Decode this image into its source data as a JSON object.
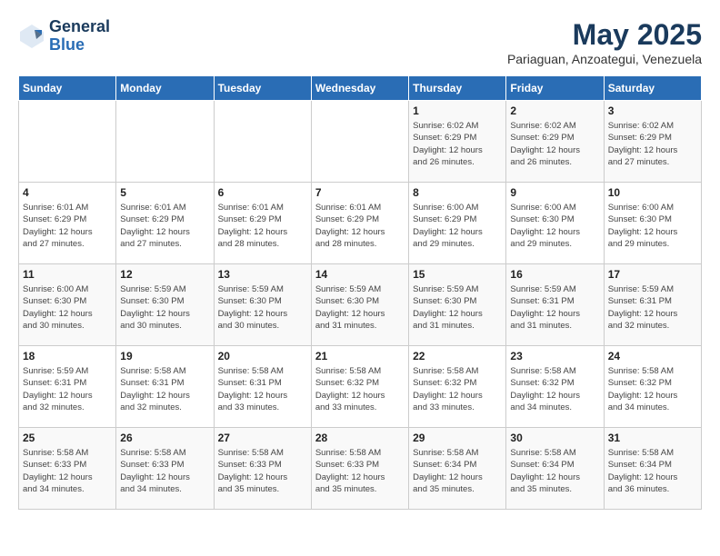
{
  "logo": {
    "general": "General",
    "blue": "Blue"
  },
  "title": "May 2025",
  "subtitle": "Pariaguan, Anzoategui, Venezuela",
  "days_of_week": [
    "Sunday",
    "Monday",
    "Tuesday",
    "Wednesday",
    "Thursday",
    "Friday",
    "Saturday"
  ],
  "weeks": [
    [
      {
        "day": "",
        "info": ""
      },
      {
        "day": "",
        "info": ""
      },
      {
        "day": "",
        "info": ""
      },
      {
        "day": "",
        "info": ""
      },
      {
        "day": "1",
        "info": "Sunrise: 6:02 AM\nSunset: 6:29 PM\nDaylight: 12 hours\nand 26 minutes."
      },
      {
        "day": "2",
        "info": "Sunrise: 6:02 AM\nSunset: 6:29 PM\nDaylight: 12 hours\nand 26 minutes."
      },
      {
        "day": "3",
        "info": "Sunrise: 6:02 AM\nSunset: 6:29 PM\nDaylight: 12 hours\nand 27 minutes."
      }
    ],
    [
      {
        "day": "4",
        "info": "Sunrise: 6:01 AM\nSunset: 6:29 PM\nDaylight: 12 hours\nand 27 minutes."
      },
      {
        "day": "5",
        "info": "Sunrise: 6:01 AM\nSunset: 6:29 PM\nDaylight: 12 hours\nand 27 minutes."
      },
      {
        "day": "6",
        "info": "Sunrise: 6:01 AM\nSunset: 6:29 PM\nDaylight: 12 hours\nand 28 minutes."
      },
      {
        "day": "7",
        "info": "Sunrise: 6:01 AM\nSunset: 6:29 PM\nDaylight: 12 hours\nand 28 minutes."
      },
      {
        "day": "8",
        "info": "Sunrise: 6:00 AM\nSunset: 6:29 PM\nDaylight: 12 hours\nand 29 minutes."
      },
      {
        "day": "9",
        "info": "Sunrise: 6:00 AM\nSunset: 6:30 PM\nDaylight: 12 hours\nand 29 minutes."
      },
      {
        "day": "10",
        "info": "Sunrise: 6:00 AM\nSunset: 6:30 PM\nDaylight: 12 hours\nand 29 minutes."
      }
    ],
    [
      {
        "day": "11",
        "info": "Sunrise: 6:00 AM\nSunset: 6:30 PM\nDaylight: 12 hours\nand 30 minutes."
      },
      {
        "day": "12",
        "info": "Sunrise: 5:59 AM\nSunset: 6:30 PM\nDaylight: 12 hours\nand 30 minutes."
      },
      {
        "day": "13",
        "info": "Sunrise: 5:59 AM\nSunset: 6:30 PM\nDaylight: 12 hours\nand 30 minutes."
      },
      {
        "day": "14",
        "info": "Sunrise: 5:59 AM\nSunset: 6:30 PM\nDaylight: 12 hours\nand 31 minutes."
      },
      {
        "day": "15",
        "info": "Sunrise: 5:59 AM\nSunset: 6:30 PM\nDaylight: 12 hours\nand 31 minutes."
      },
      {
        "day": "16",
        "info": "Sunrise: 5:59 AM\nSunset: 6:31 PM\nDaylight: 12 hours\nand 31 minutes."
      },
      {
        "day": "17",
        "info": "Sunrise: 5:59 AM\nSunset: 6:31 PM\nDaylight: 12 hours\nand 32 minutes."
      }
    ],
    [
      {
        "day": "18",
        "info": "Sunrise: 5:59 AM\nSunset: 6:31 PM\nDaylight: 12 hours\nand 32 minutes."
      },
      {
        "day": "19",
        "info": "Sunrise: 5:58 AM\nSunset: 6:31 PM\nDaylight: 12 hours\nand 32 minutes."
      },
      {
        "day": "20",
        "info": "Sunrise: 5:58 AM\nSunset: 6:31 PM\nDaylight: 12 hours\nand 33 minutes."
      },
      {
        "day": "21",
        "info": "Sunrise: 5:58 AM\nSunset: 6:32 PM\nDaylight: 12 hours\nand 33 minutes."
      },
      {
        "day": "22",
        "info": "Sunrise: 5:58 AM\nSunset: 6:32 PM\nDaylight: 12 hours\nand 33 minutes."
      },
      {
        "day": "23",
        "info": "Sunrise: 5:58 AM\nSunset: 6:32 PM\nDaylight: 12 hours\nand 34 minutes."
      },
      {
        "day": "24",
        "info": "Sunrise: 5:58 AM\nSunset: 6:32 PM\nDaylight: 12 hours\nand 34 minutes."
      }
    ],
    [
      {
        "day": "25",
        "info": "Sunrise: 5:58 AM\nSunset: 6:33 PM\nDaylight: 12 hours\nand 34 minutes."
      },
      {
        "day": "26",
        "info": "Sunrise: 5:58 AM\nSunset: 6:33 PM\nDaylight: 12 hours\nand 34 minutes."
      },
      {
        "day": "27",
        "info": "Sunrise: 5:58 AM\nSunset: 6:33 PM\nDaylight: 12 hours\nand 35 minutes."
      },
      {
        "day": "28",
        "info": "Sunrise: 5:58 AM\nSunset: 6:33 PM\nDaylight: 12 hours\nand 35 minutes."
      },
      {
        "day": "29",
        "info": "Sunrise: 5:58 AM\nSunset: 6:34 PM\nDaylight: 12 hours\nand 35 minutes."
      },
      {
        "day": "30",
        "info": "Sunrise: 5:58 AM\nSunset: 6:34 PM\nDaylight: 12 hours\nand 35 minutes."
      },
      {
        "day": "31",
        "info": "Sunrise: 5:58 AM\nSunset: 6:34 PM\nDaylight: 12 hours\nand 36 minutes."
      }
    ]
  ]
}
